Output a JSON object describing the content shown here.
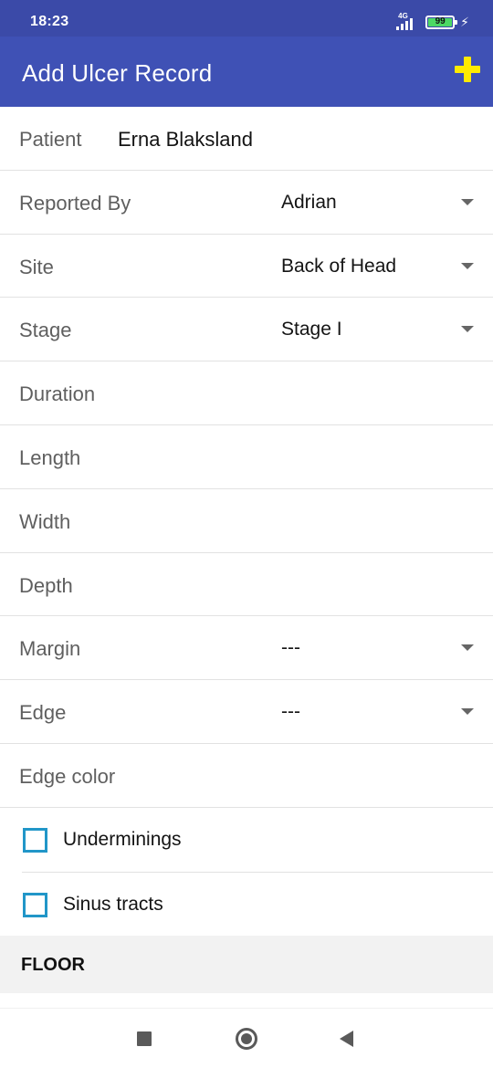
{
  "status_bar": {
    "time": "18:23",
    "network": "4G",
    "battery": "99",
    "battery_level_percent": 99,
    "battery_color": "#4cd964"
  },
  "app_bar": {
    "title": "Add Ulcer Record",
    "add_icon": "plus-icon",
    "add_icon_color": "#ffeb00",
    "background_color": "#3f51b5"
  },
  "form": {
    "patient": {
      "label": "Patient",
      "value": "Erna Blaksland"
    },
    "reported_by": {
      "label": "Reported By",
      "value": "Adrian"
    },
    "site": {
      "label": "Site",
      "value": "Back of Head"
    },
    "stage": {
      "label": "Stage",
      "value": "Stage I"
    },
    "duration": {
      "label": "Duration"
    },
    "length": {
      "label": "Length"
    },
    "width": {
      "label": "Width"
    },
    "depth": {
      "label": "Depth"
    },
    "margin": {
      "label": "Margin",
      "value": "---"
    },
    "edge": {
      "label": "Edge",
      "value": "---"
    },
    "edge_color": {
      "label": "Edge color"
    },
    "underminings": {
      "label": "Underminings",
      "checked": false
    },
    "sinus_tracts": {
      "label": "Sinus tracts",
      "checked": false
    },
    "checkbox_color": "#2196c8"
  },
  "section": {
    "title": "FLOOR"
  },
  "nav_bar": {
    "recents_icon": "square-icon",
    "home_icon": "circle-home-icon",
    "back_icon": "triangle-back-icon"
  }
}
